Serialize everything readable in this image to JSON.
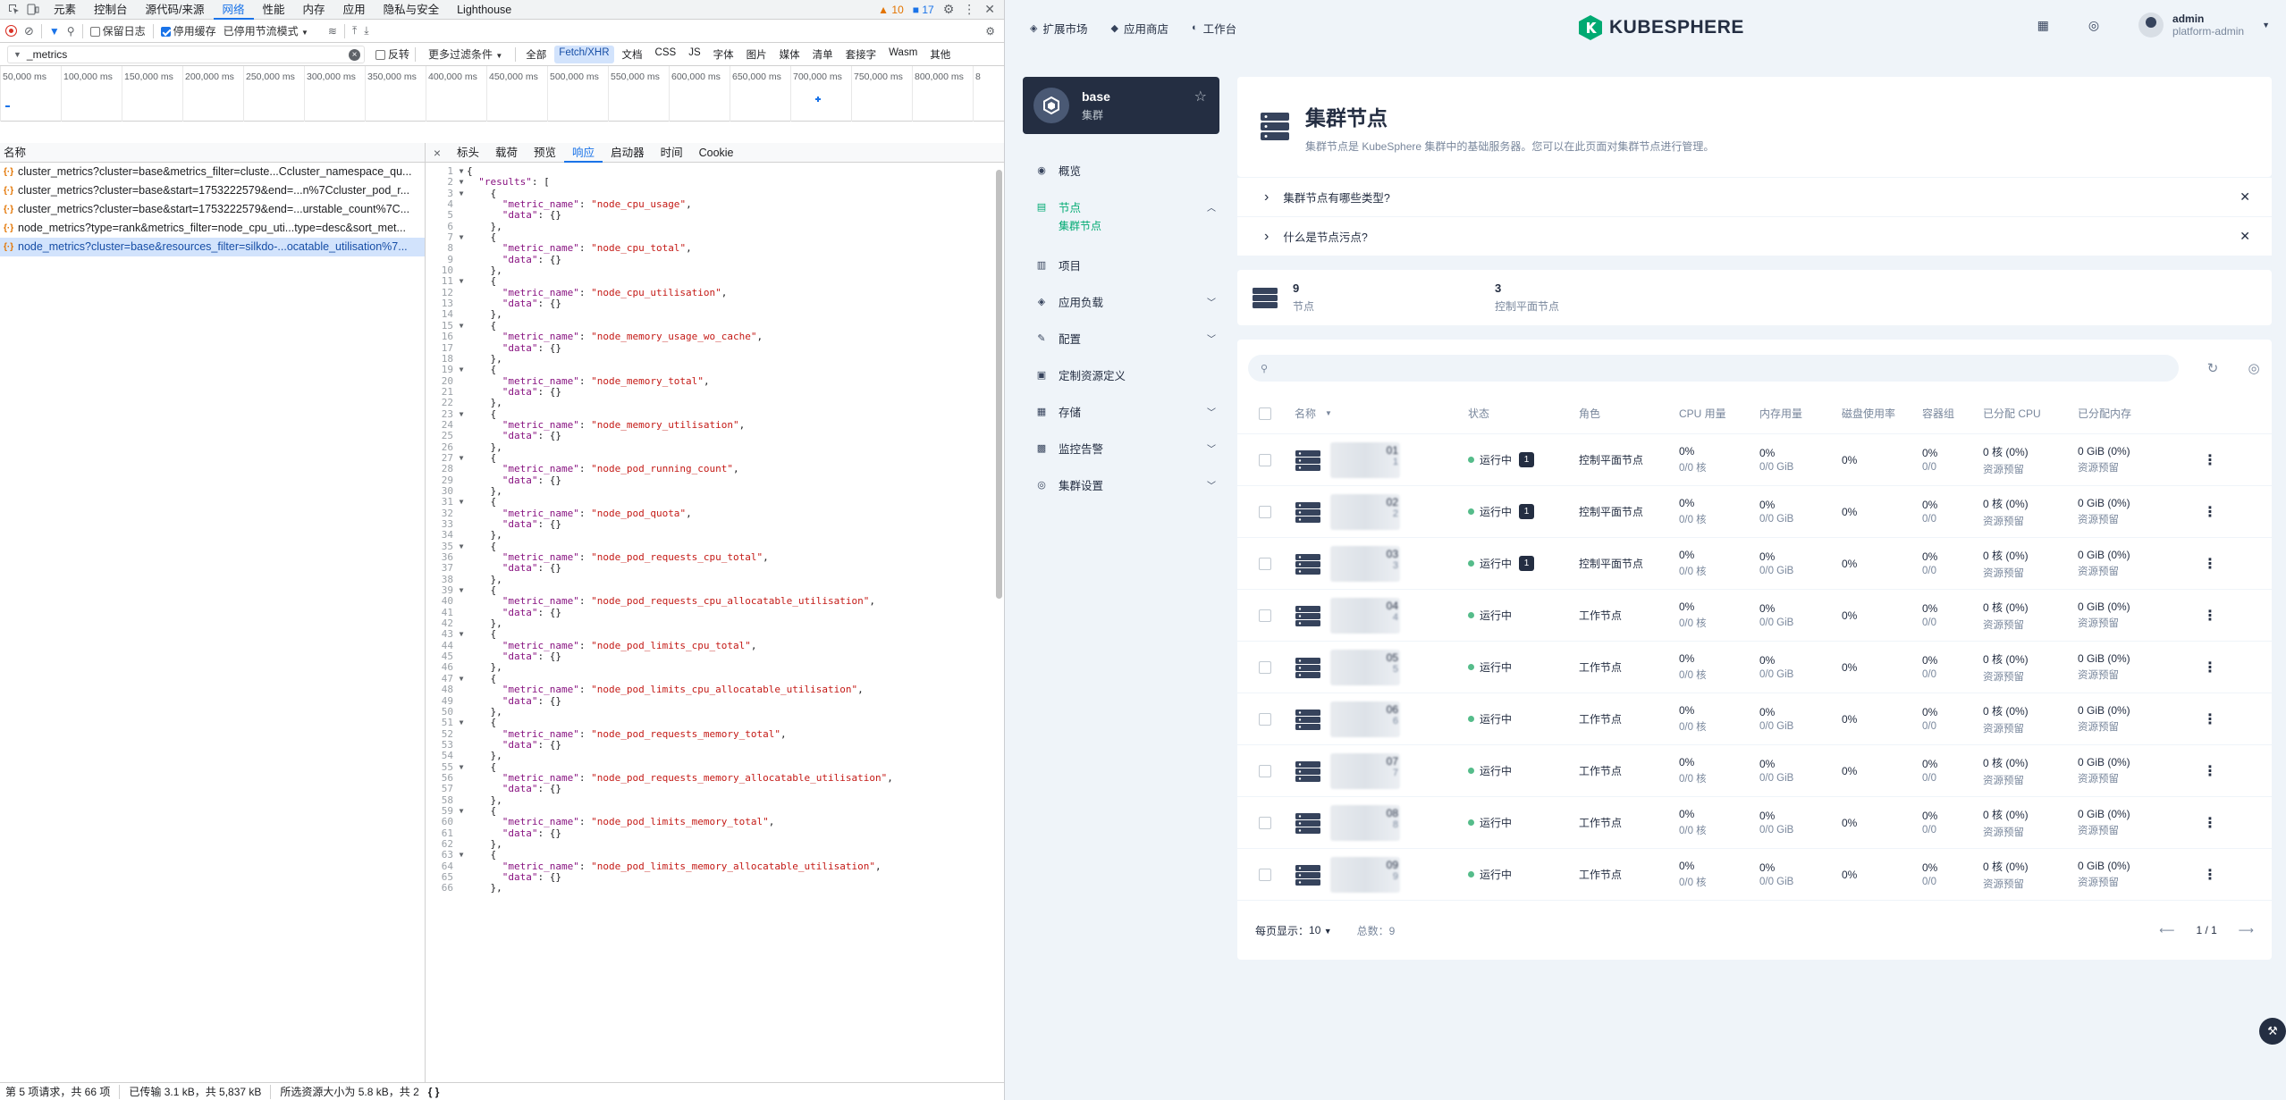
{
  "devtools": {
    "tabs": [
      "元素",
      "控制台",
      "源代码/来源",
      "网络",
      "性能",
      "内存",
      "应用",
      "隐私与安全",
      "Lighthouse"
    ],
    "active_tab": "网络",
    "warnings": "10",
    "infos": "17",
    "toolbar": {
      "preserve_log": "保留日志",
      "disable_cache": "停用缓存",
      "throttle": "已停用节流模式"
    },
    "filter": {
      "value": "_metrics",
      "invert": "反转",
      "more": "更多过滤条件",
      "chips": [
        "全部",
        "Fetch/XHR",
        "文档",
        "CSS",
        "JS",
        "字体",
        "图片",
        "媒体",
        "清单",
        "套接字",
        "Wasm",
        "其他"
      ],
      "active_chip": "Fetch/XHR"
    },
    "timeline": [
      "50,000 ms",
      "100,000 ms",
      "150,000 ms",
      "200,000 ms",
      "250,000 ms",
      "300,000 ms",
      "350,000 ms",
      "400,000 ms",
      "450,000 ms",
      "500,000 ms",
      "550,000 ms",
      "600,000 ms",
      "650,000 ms",
      "700,000 ms",
      "750,000 ms",
      "800,000 ms",
      "8"
    ],
    "list_header": "名称",
    "requests": [
      "cluster_metrics?cluster=base&metrics_filter=cluste...Ccluster_namespace_qu...",
      "cluster_metrics?cluster=base&start=1753222579&end=...n%7Ccluster_pod_r...",
      "cluster_metrics?cluster=base&start=1753222579&end=...urstable_count%7C...",
      "node_metrics?type=rank&metrics_filter=node_cpu_uti...type=desc&sort_met...",
      "node_metrics?cluster=base&resources_filter=silkdo-...ocatable_utilisation%7..."
    ],
    "selected_request": 4,
    "detail_tabs": [
      "标头",
      "载荷",
      "预览",
      "响应",
      "启动器",
      "时间",
      "Cookie"
    ],
    "active_detail_tab": "响应",
    "metrics": [
      "node_cpu_usage",
      "node_cpu_total",
      "node_cpu_utilisation",
      "node_memory_usage_wo_cache",
      "node_memory_total",
      "node_memory_utilisation",
      "node_pod_running_count",
      "node_pod_quota",
      "node_pod_requests_cpu_total",
      "node_pod_requests_cpu_allocatable_utilisation",
      "node_pod_limits_cpu_total",
      "node_pod_limits_cpu_allocatable_utilisation",
      "node_pod_requests_memory_total",
      "node_pod_requests_memory_allocatable_utilisation",
      "node_pod_limits_memory_total",
      "node_pod_limits_memory_allocatable_utilisation"
    ],
    "status": {
      "requests": "第 5 项请求，共 66 项",
      "transferred": "已传输 3.1 kB，共 5,837 kB",
      "selected": "所选资源大小为 5.8 kB，共 2"
    }
  },
  "ks": {
    "nav": [
      "扩展市场",
      "应用商店",
      "工作台"
    ],
    "logo": "KUBESPHERE",
    "user": {
      "name": "admin",
      "role": "platform-admin"
    },
    "cluster": {
      "name": "base",
      "sub": "集群"
    },
    "menu": [
      {
        "label": "概览",
        "icon": "overview-icon",
        "chev": false
      },
      {
        "label": "节点",
        "icon": "node-icon",
        "chev": true,
        "active": true
      },
      {
        "label": "项目",
        "icon": "project-icon",
        "chev": false
      },
      {
        "label": "应用负载",
        "icon": "workload-icon",
        "chev": true
      },
      {
        "label": "配置",
        "icon": "config-icon",
        "chev": true
      },
      {
        "label": "定制资源定义",
        "icon": "crd-icon",
        "chev": false
      },
      {
        "label": "存储",
        "icon": "storage-icon",
        "chev": true
      },
      {
        "label": "监控告警",
        "icon": "monitor-icon",
        "chev": true
      },
      {
        "label": "集群设置",
        "icon": "settings-icon",
        "chev": true
      }
    ],
    "submenu_active": "集群节点",
    "banner": {
      "title": "集群节点",
      "desc": "集群节点是 KubeSphere 集群中的基础服务器。您可以在此页面对集群节点进行管理。"
    },
    "faq": [
      "集群节点有哪些类型?",
      "什么是节点污点?"
    ],
    "stats": [
      {
        "num": "9",
        "label": "节点"
      },
      {
        "num": "3",
        "label": "控制平面节点"
      }
    ],
    "columns": [
      "名称",
      "状态",
      "角色",
      "CPU 用量",
      "内存用量",
      "磁盘使用率",
      "容器组",
      "已分配 CPU",
      "已分配内存"
    ],
    "rows": [
      {
        "suffix": "01",
        "suffix2": "1",
        "status": "运行中",
        "taint": "1",
        "role": "控制平面节点"
      },
      {
        "suffix": "02",
        "suffix2": "2",
        "status": "运行中",
        "taint": "1",
        "role": "控制平面节点"
      },
      {
        "suffix": "03",
        "suffix2": "3",
        "status": "运行中",
        "taint": "1",
        "role": "控制平面节点"
      },
      {
        "suffix": "04",
        "suffix2": "4",
        "status": "运行中",
        "taint": "",
        "role": "工作节点"
      },
      {
        "suffix": "05",
        "suffix2": "5",
        "status": "运行中",
        "taint": "",
        "role": "工作节点"
      },
      {
        "suffix": "06",
        "suffix2": "6",
        "status": "运行中",
        "taint": "",
        "role": "工作节点"
      },
      {
        "suffix": "07",
        "suffix2": "7",
        "status": "运行中",
        "taint": "",
        "role": "工作节点"
      },
      {
        "suffix": "08",
        "suffix2": "8",
        "status": "运行中",
        "taint": "",
        "role": "工作节点"
      },
      {
        "suffix": "09",
        "suffix2": "9",
        "status": "运行中",
        "taint": "",
        "role": "工作节点"
      }
    ],
    "cell": {
      "cpu": "0%",
      "cpu_sub": "0/0 核",
      "mem": "0%",
      "mem_sub": "0/0 GiB",
      "disk": "0%",
      "pods": "0%",
      "pods_sub": "0/0",
      "alloc_cpu": "0 核  (0%)",
      "alloc_cpu_sub": "资源预留",
      "alloc_mem": "0 GiB  (0%)",
      "alloc_mem_sub": "资源预留"
    },
    "pager": {
      "per_page_label": "每页显示：",
      "per_page": "10",
      "total": "总数：9",
      "page": "1 / 1"
    }
  }
}
